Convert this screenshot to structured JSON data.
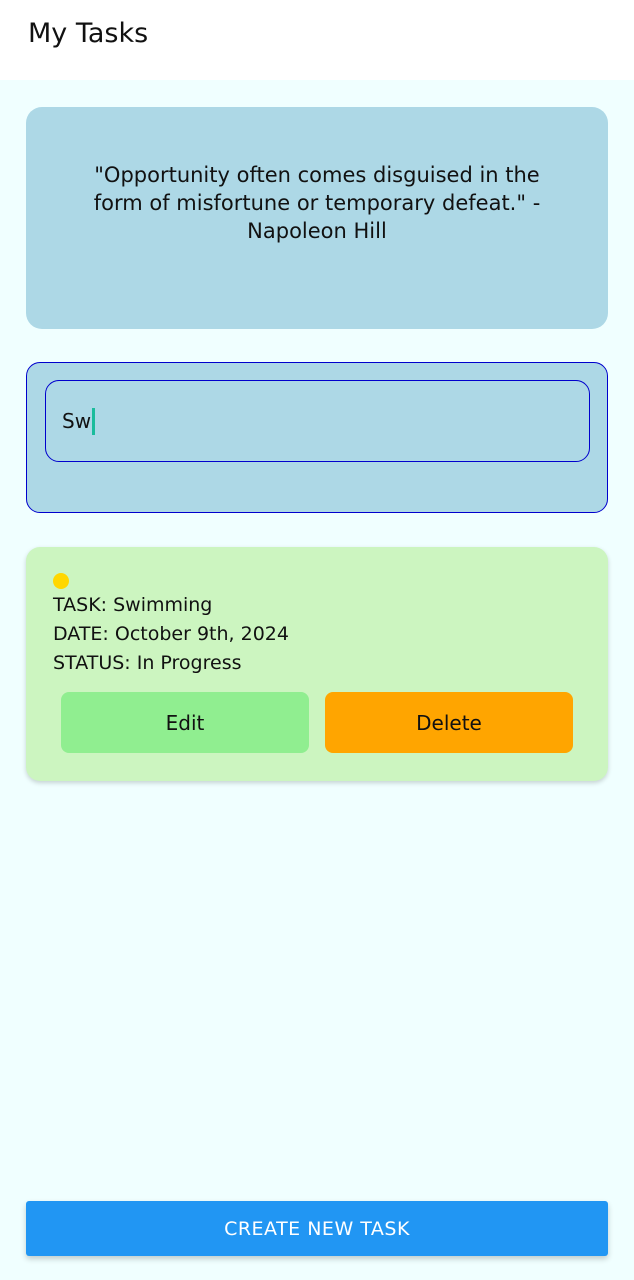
{
  "app_bar": {
    "title": "My Tasks"
  },
  "quote": {
    "text": "\"Opportunity often comes disguised in the form of misfortune or temporary defeat.\" - Napoleon Hill"
  },
  "search": {
    "value": "Sw"
  },
  "tasks": [
    {
      "task_line": "TASK: Swimming",
      "date_line": "DATE: October 9th, 2024",
      "status_line": "STATUS: In Progress",
      "status_color": "#FFD700",
      "edit_label": "Edit",
      "delete_label": "Delete"
    }
  ],
  "footer": {
    "create_label": "CREATE NEW TASK"
  },
  "colors": {
    "background": "#F0FFFF",
    "quote_card": "#ADD8E6",
    "search_border": "#0000CD",
    "task_card": "#CCF5C0",
    "edit_button": "#90EE90",
    "delete_button": "#FFA500",
    "create_button": "#2196F3",
    "caret": "#1ABC9C"
  }
}
